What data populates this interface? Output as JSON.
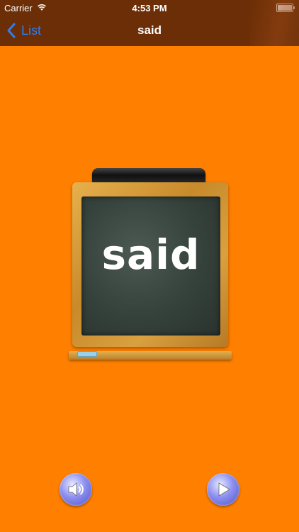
{
  "status_bar": {
    "carrier": "Carrier",
    "time": "4:53 PM",
    "battery_level": 1.0
  },
  "nav": {
    "back_label": "List",
    "title": "said"
  },
  "board": {
    "word": "said"
  },
  "controls": {
    "sound_icon": "speaker-icon",
    "play_icon": "play-icon"
  },
  "colors": {
    "background": "#ff7f00",
    "navbar": "#6b2e06",
    "back_link": "#2b7ef5"
  }
}
